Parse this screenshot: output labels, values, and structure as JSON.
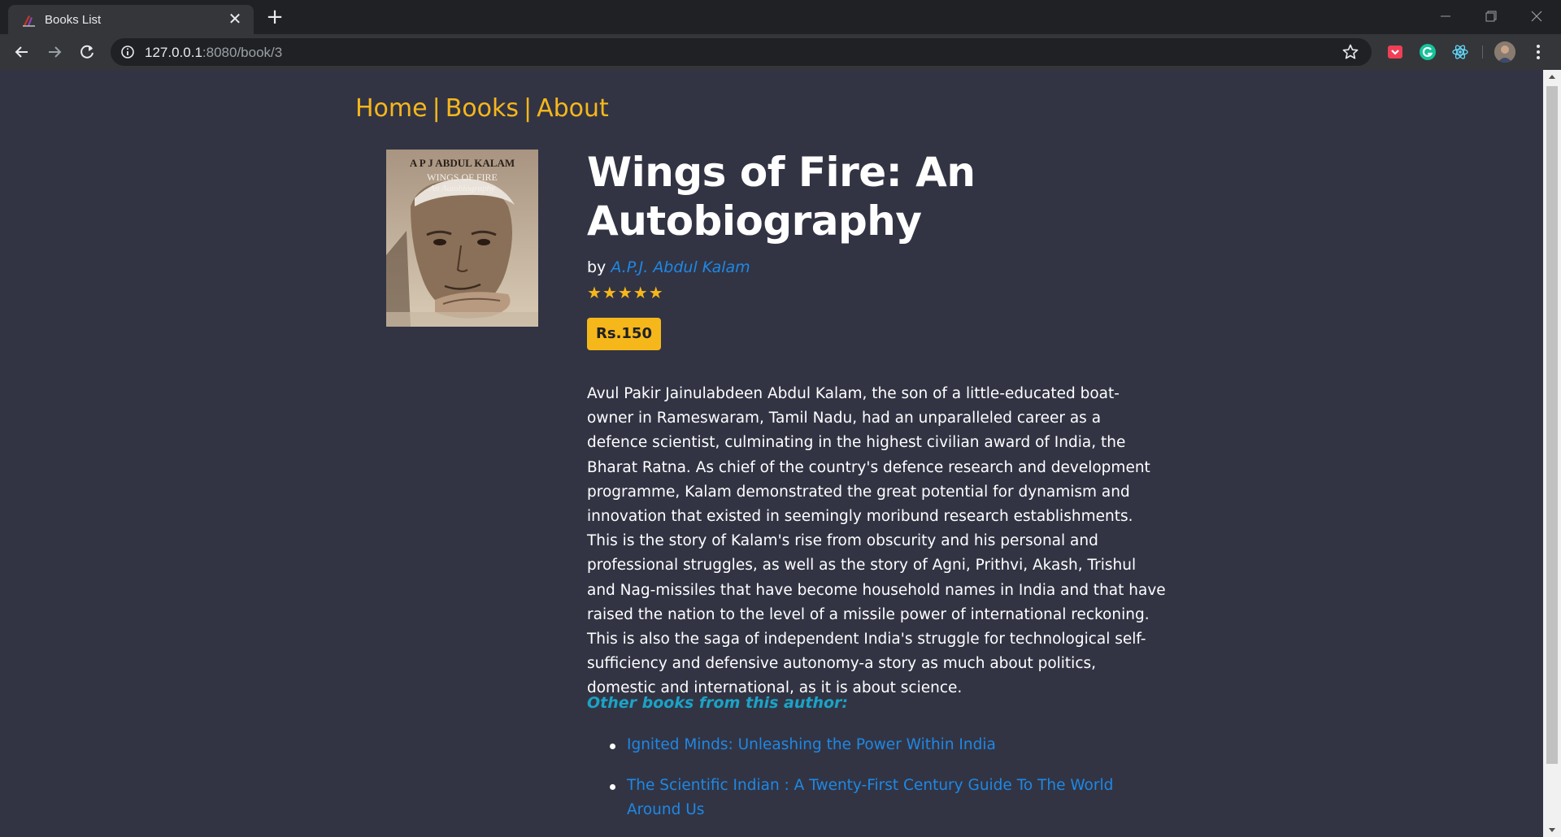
{
  "browser": {
    "tab_title": "Books List",
    "url_host": "127.0.0.1",
    "url_rest": ":8080/book/3",
    "close_glyph": "✕",
    "new_tab_glyph": "+"
  },
  "nav": {
    "home": "Home",
    "books": "Books",
    "about": "About",
    "separator": "|"
  },
  "book": {
    "cover_author": "A P J ABDUL KALAM",
    "cover_title": "WINGS OF FIRE",
    "cover_subtitle": "An Autobiography",
    "title": "Wings of Fire: An Autobiography",
    "by_label": "by",
    "author": "A.P.J. Abdul Kalam",
    "rating_stars": "★★★★★",
    "rating": 5,
    "price": "Rs.150",
    "description": "Avul Pakir Jainulabdeen Abdul Kalam, the son of a little-educated boat-owner in Rameswaram, Tamil Nadu, had an unparalleled career as a defence scientist, culminating in the highest civilian award of India, the Bharat Ratna. As chief of the country's defence research and development programme, Kalam demonstrated the great potential for dynamism and innovation that existed in seemingly moribund research establishments. This is the story of Kalam's rise from obscurity and his personal and professional struggles, as well as the story of Agni, Prithvi, Akash, Trishul and Nag-missiles that have become household names in India and that have raised the nation to the level of a missile power of international reckoning. This is also the saga of independent India's struggle for technological self-sufficiency and defensive autonomy-a story as much about politics, domestic and international, as it is about science."
  },
  "other_books": {
    "heading": "Other books from this author:",
    "items": [
      {
        "title": "Ignited Minds: Unleashing the Power Within India"
      },
      {
        "title": "The Scientific Indian : A Twenty-First Century Guide To The World Around Us"
      }
    ]
  },
  "colors": {
    "page_bg": "#323444",
    "accent_yellow": "#f6b71b",
    "link_blue": "#1e88e5",
    "heading_teal": "#1ba3c6"
  },
  "icons": [
    "back-arrow-icon",
    "forward-arrow-icon",
    "reload-icon",
    "info-icon",
    "bookmark-star-icon",
    "pocket-icon",
    "grammarly-icon",
    "react-devtools-icon",
    "kebab-menu-icon"
  ]
}
